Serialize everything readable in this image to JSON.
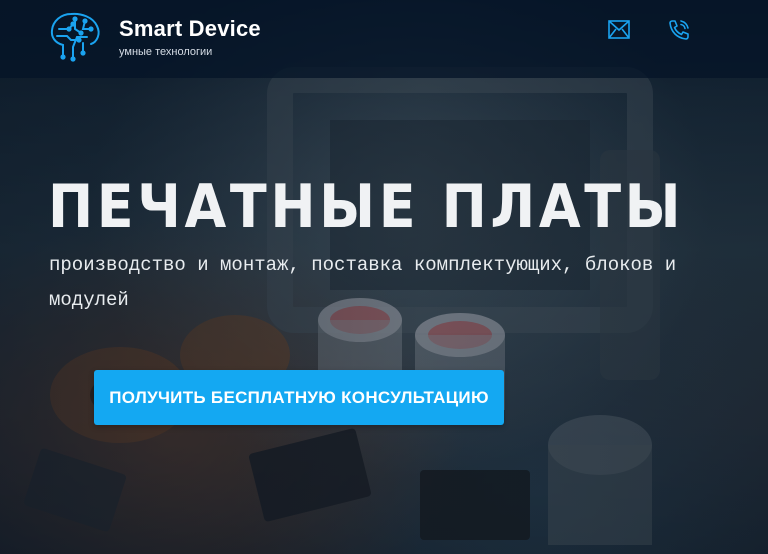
{
  "header": {
    "brand_name": "Smart Device",
    "brand_tagline": "умные технологии",
    "icons": {
      "logo": "circuit-brain-icon",
      "mail": "mail-icon",
      "phone": "phone-icon"
    },
    "accent_color": "#1aa3f0"
  },
  "hero": {
    "title": "ПЕЧАТНЫЕ ПЛАТЫ",
    "subtitle": "производство и монтаж, поставка комплектующих, блоков и модулей",
    "cta_label": "ПОЛУЧИТЬ БЕСПЛАТНУЮ КОНСУЛЬТАЦИЮ",
    "cta_color": "#14a8f2",
    "background_image": "circuit-board-photo"
  }
}
